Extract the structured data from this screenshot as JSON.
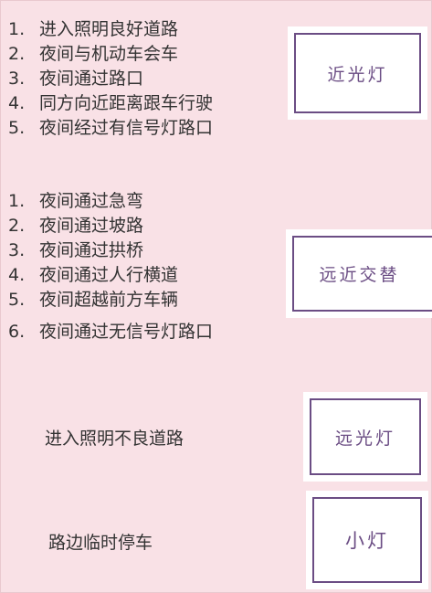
{
  "group1": {
    "items": [
      {
        "num": "1.",
        "text": "进入照明良好道路"
      },
      {
        "num": "2.",
        "text": "夜间与机动车会车"
      },
      {
        "num": "3.",
        "text": "夜间通过路口"
      },
      {
        "num": "4.",
        "text": "同方向近距离跟车行驶"
      },
      {
        "num": "5.",
        "text": "夜间经过有信号灯路口"
      }
    ],
    "light": "近光灯"
  },
  "group2": {
    "items": [
      {
        "num": "1.",
        "text": "夜间通过急弯"
      },
      {
        "num": "2.",
        "text": "夜间通过坡路"
      },
      {
        "num": "3.",
        "text": "夜间通过拱桥"
      },
      {
        "num": "4.",
        "text": "夜间通过人行横道"
      },
      {
        "num": "5.",
        "text": "夜间超越前方车辆"
      },
      {
        "num": "6.",
        "text": "夜间通过无信号灯路口"
      }
    ],
    "light": "远近交替"
  },
  "group3": {
    "text": "进入照明不良道路",
    "light": "远光灯"
  },
  "group4": {
    "text": "路边临时停车",
    "light": "小灯"
  },
  "colors": {
    "background": "#f9e1e6",
    "text": "#333333",
    "accent": "#6b4d84",
    "card": "#ffffff"
  }
}
